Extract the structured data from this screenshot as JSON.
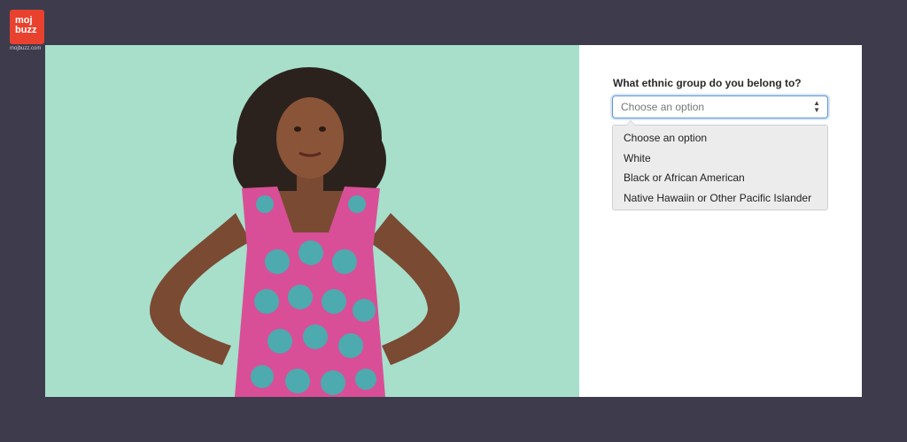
{
  "brand": {
    "logo_line1": "moj",
    "logo_line2": "buzz",
    "url": "mojbuzz.com",
    "color": "#e8422f"
  },
  "colors": {
    "background": "#3e3b4d",
    "photo_background": "#a7dfcb",
    "focus_border": "#5b97d8"
  },
  "form": {
    "question": "What ethnic group do you belong to?",
    "select": {
      "selected": "Choose an option",
      "icon": "sort-arrows-icon"
    },
    "options": [
      "Choose an option",
      "White",
      "Black or African American",
      "Native Hawaiin or Other Pacific Islander"
    ]
  }
}
